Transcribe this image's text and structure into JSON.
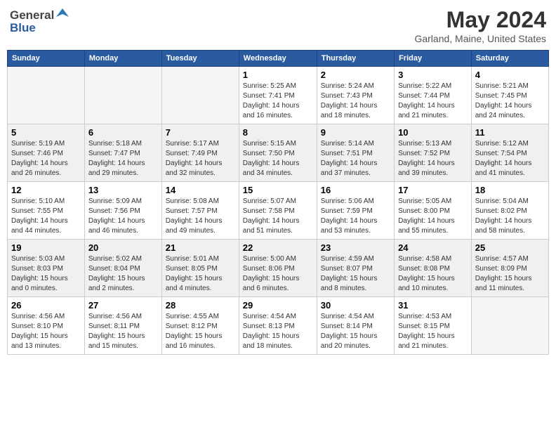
{
  "logo": {
    "general": "General",
    "blue": "Blue"
  },
  "title": "May 2024",
  "location": "Garland, Maine, United States",
  "days_header": [
    "Sunday",
    "Monday",
    "Tuesday",
    "Wednesday",
    "Thursday",
    "Friday",
    "Saturday"
  ],
  "weeks": [
    {
      "shaded": false,
      "days": [
        {
          "number": "",
          "info": "",
          "empty": true
        },
        {
          "number": "",
          "info": "",
          "empty": true
        },
        {
          "number": "",
          "info": "",
          "empty": true
        },
        {
          "number": "1",
          "info": "Sunrise: 5:25 AM\nSunset: 7:41 PM\nDaylight: 14 hours\nand 16 minutes."
        },
        {
          "number": "2",
          "info": "Sunrise: 5:24 AM\nSunset: 7:43 PM\nDaylight: 14 hours\nand 18 minutes."
        },
        {
          "number": "3",
          "info": "Sunrise: 5:22 AM\nSunset: 7:44 PM\nDaylight: 14 hours\nand 21 minutes."
        },
        {
          "number": "4",
          "info": "Sunrise: 5:21 AM\nSunset: 7:45 PM\nDaylight: 14 hours\nand 24 minutes."
        }
      ]
    },
    {
      "shaded": true,
      "days": [
        {
          "number": "5",
          "info": "Sunrise: 5:19 AM\nSunset: 7:46 PM\nDaylight: 14 hours\nand 26 minutes."
        },
        {
          "number": "6",
          "info": "Sunrise: 5:18 AM\nSunset: 7:47 PM\nDaylight: 14 hours\nand 29 minutes."
        },
        {
          "number": "7",
          "info": "Sunrise: 5:17 AM\nSunset: 7:49 PM\nDaylight: 14 hours\nand 32 minutes."
        },
        {
          "number": "8",
          "info": "Sunrise: 5:15 AM\nSunset: 7:50 PM\nDaylight: 14 hours\nand 34 minutes."
        },
        {
          "number": "9",
          "info": "Sunrise: 5:14 AM\nSunset: 7:51 PM\nDaylight: 14 hours\nand 37 minutes."
        },
        {
          "number": "10",
          "info": "Sunrise: 5:13 AM\nSunset: 7:52 PM\nDaylight: 14 hours\nand 39 minutes."
        },
        {
          "number": "11",
          "info": "Sunrise: 5:12 AM\nSunset: 7:54 PM\nDaylight: 14 hours\nand 41 minutes."
        }
      ]
    },
    {
      "shaded": false,
      "days": [
        {
          "number": "12",
          "info": "Sunrise: 5:10 AM\nSunset: 7:55 PM\nDaylight: 14 hours\nand 44 minutes."
        },
        {
          "number": "13",
          "info": "Sunrise: 5:09 AM\nSunset: 7:56 PM\nDaylight: 14 hours\nand 46 minutes."
        },
        {
          "number": "14",
          "info": "Sunrise: 5:08 AM\nSunset: 7:57 PM\nDaylight: 14 hours\nand 49 minutes."
        },
        {
          "number": "15",
          "info": "Sunrise: 5:07 AM\nSunset: 7:58 PM\nDaylight: 14 hours\nand 51 minutes."
        },
        {
          "number": "16",
          "info": "Sunrise: 5:06 AM\nSunset: 7:59 PM\nDaylight: 14 hours\nand 53 minutes."
        },
        {
          "number": "17",
          "info": "Sunrise: 5:05 AM\nSunset: 8:00 PM\nDaylight: 14 hours\nand 55 minutes."
        },
        {
          "number": "18",
          "info": "Sunrise: 5:04 AM\nSunset: 8:02 PM\nDaylight: 14 hours\nand 58 minutes."
        }
      ]
    },
    {
      "shaded": true,
      "days": [
        {
          "number": "19",
          "info": "Sunrise: 5:03 AM\nSunset: 8:03 PM\nDaylight: 15 hours\nand 0 minutes."
        },
        {
          "number": "20",
          "info": "Sunrise: 5:02 AM\nSunset: 8:04 PM\nDaylight: 15 hours\nand 2 minutes."
        },
        {
          "number": "21",
          "info": "Sunrise: 5:01 AM\nSunset: 8:05 PM\nDaylight: 15 hours\nand 4 minutes."
        },
        {
          "number": "22",
          "info": "Sunrise: 5:00 AM\nSunset: 8:06 PM\nDaylight: 15 hours\nand 6 minutes."
        },
        {
          "number": "23",
          "info": "Sunrise: 4:59 AM\nSunset: 8:07 PM\nDaylight: 15 hours\nand 8 minutes."
        },
        {
          "number": "24",
          "info": "Sunrise: 4:58 AM\nSunset: 8:08 PM\nDaylight: 15 hours\nand 10 minutes."
        },
        {
          "number": "25",
          "info": "Sunrise: 4:57 AM\nSunset: 8:09 PM\nDaylight: 15 hours\nand 11 minutes."
        }
      ]
    },
    {
      "shaded": false,
      "days": [
        {
          "number": "26",
          "info": "Sunrise: 4:56 AM\nSunset: 8:10 PM\nDaylight: 15 hours\nand 13 minutes."
        },
        {
          "number": "27",
          "info": "Sunrise: 4:56 AM\nSunset: 8:11 PM\nDaylight: 15 hours\nand 15 minutes."
        },
        {
          "number": "28",
          "info": "Sunrise: 4:55 AM\nSunset: 8:12 PM\nDaylight: 15 hours\nand 16 minutes."
        },
        {
          "number": "29",
          "info": "Sunrise: 4:54 AM\nSunset: 8:13 PM\nDaylight: 15 hours\nand 18 minutes."
        },
        {
          "number": "30",
          "info": "Sunrise: 4:54 AM\nSunset: 8:14 PM\nDaylight: 15 hours\nand 20 minutes."
        },
        {
          "number": "31",
          "info": "Sunrise: 4:53 AM\nSunset: 8:15 PM\nDaylight: 15 hours\nand 21 minutes."
        },
        {
          "number": "",
          "info": "",
          "empty": true
        }
      ]
    }
  ]
}
